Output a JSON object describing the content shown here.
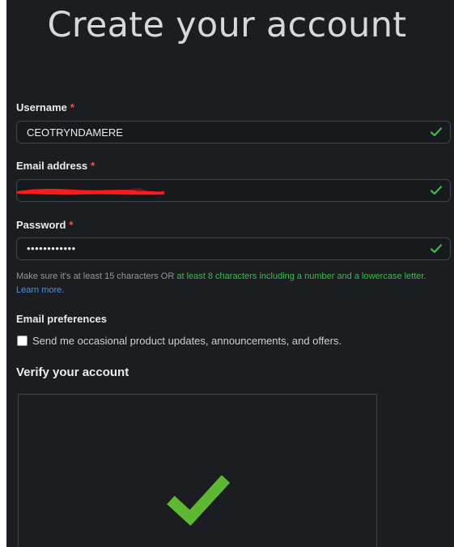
{
  "header": {
    "title": "Create your account"
  },
  "form": {
    "required_marker": "*",
    "username": {
      "label": "Username",
      "value": "CEOTRYNDAMERE",
      "status": "valid"
    },
    "email": {
      "label": "Email address",
      "value_redacted": true,
      "status": "valid"
    },
    "password": {
      "label": "Password",
      "value": "••••••••••••",
      "status": "valid"
    },
    "password_hint": {
      "text_before": "Make sure it's at least 15 characters OR ",
      "text_ok": "at least 8 characters including a number and a lowercase letter.",
      "link": "Learn more",
      "after_link": "."
    },
    "email_preferences": {
      "heading": "Email preferences",
      "checkbox_label": "Send me occasional product updates, announcements, and offers.",
      "checked": false
    },
    "verify": {
      "heading": "Verify your account",
      "status": "verified"
    }
  },
  "colors": {
    "background": "#1b1d20",
    "success": "#3fb950",
    "captcha_check": "#5fb832",
    "required": "#f85149",
    "link": "#4493f8",
    "redaction": "#ff1a1a"
  },
  "icons": {
    "field_status": "checkmark-icon",
    "captcha_status": "large-checkmark-icon"
  }
}
